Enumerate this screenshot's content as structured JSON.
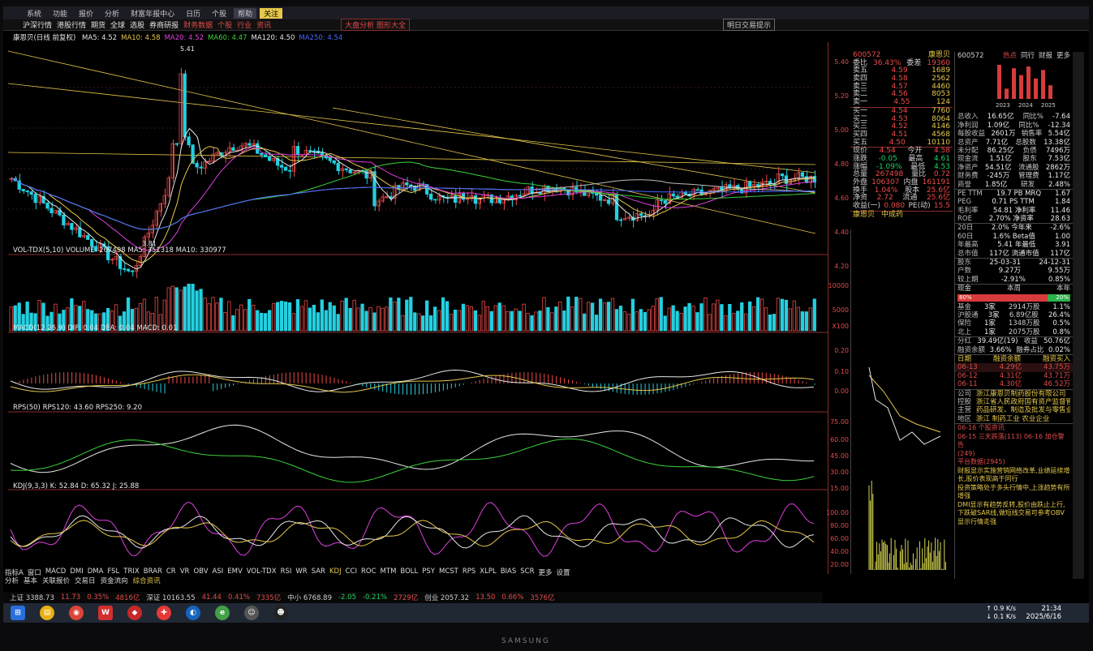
{
  "menubar": {
    "items": [
      "系统",
      "功能",
      "报价",
      "分析",
      "财富年报中心",
      "日历",
      "个股",
      "帮助",
      "关注"
    ],
    "active_index": 7,
    "hl_index": 8
  },
  "toolbar": {
    "items": [
      "沪深行情",
      "港股行情",
      "期货",
      "全球",
      "选股",
      "券商研报",
      "财务数据",
      "个股",
      "行业",
      "资讯"
    ],
    "alert_box": "大盘分析 图形大全",
    "right_box": "明日交易提示"
  },
  "chart": {
    "title": "康恩贝(日线 前复权)",
    "ma_legend": [
      {
        "text": "MA5: 4.52",
        "color": "#e8e8e8"
      },
      {
        "text": "MA10: 4.58",
        "color": "#e6c84a"
      },
      {
        "text": "MA20: 4.52",
        "color": "#e040e0"
      },
      {
        "text": "MA60: 4.47",
        "color": "#3cd23c"
      },
      {
        "text": "MA120: 4.50",
        "color": "#e8e8e8"
      },
      {
        "text": "MA250: 4.54",
        "color": "#4466ff"
      }
    ],
    "high_label": "5.41",
    "low_label": "3.81",
    "volume_legend": "VOL-TDX(5,10) VOLUME: 267498 MA5: 351318 MA10: 330977",
    "macd_legend": "MACD(12,26,9) DIF: 0.04 DEA: 0.04 MACD: 0.01",
    "rps_legend": "RPS(50) RPS120: 43.60 RPS250: 9.20",
    "kdj_legend": "KDJ(9,3,3) K: 52.84 D: 65.32 J: 25.88"
  },
  "axis_ticks": [
    "5.40",
    "5.20",
    "5.00",
    "4.80",
    "4.60",
    "4.40",
    "4.20",
    "10000",
    "5000",
    "X100",
    "0.20",
    "0.10",
    "0.00",
    "75.00",
    "60.00",
    "45.00",
    "30.00",
    "15.00",
    "100.00",
    "80.00",
    "60.00",
    "40.00",
    "20.00"
  ],
  "quote": {
    "code": "600572",
    "name": "康恩贝",
    "weibi_label": "委比",
    "weibi": "36.43%",
    "weicha_label": "委差",
    "weicha": "19360",
    "sell": [
      {
        "label": "卖五",
        "price": "4.59",
        "vol": "1689"
      },
      {
        "label": "卖四",
        "price": "4.58",
        "vol": "2562"
      },
      {
        "label": "卖三",
        "price": "4.57",
        "vol": "4460"
      },
      {
        "label": "卖二",
        "price": "4.56",
        "vol": "8053"
      },
      {
        "label": "卖一",
        "price": "4.55",
        "vol": "124"
      }
    ],
    "buy": [
      {
        "label": "买一",
        "price": "4.54",
        "vol": "7760"
      },
      {
        "label": "买二",
        "price": "4.53",
        "vol": "8064"
      },
      {
        "label": "买三",
        "price": "4.52",
        "vol": "4146"
      },
      {
        "label": "买四",
        "price": "4.51",
        "vol": "4568"
      },
      {
        "label": "买五",
        "price": "4.50",
        "vol": "10110"
      }
    ],
    "stats": [
      [
        "现价",
        "4.54",
        "今开",
        "4.58"
      ],
      [
        "涨跌",
        "-0.05",
        "最高",
        "4.61"
      ],
      [
        "涨幅",
        "-1.09%",
        "最低",
        "4.53"
      ],
      [
        "总量",
        "267498",
        "量比",
        "0.72"
      ],
      [
        "外盘",
        "106307",
        "内盘",
        "161191"
      ],
      [
        "换手",
        "1.04%",
        "股本",
        "25.6亿"
      ],
      [
        "净资",
        "2.72",
        "流通",
        "25.6亿"
      ],
      [
        "收益(一)",
        "0.080",
        "PE(动)",
        "15.5"
      ]
    ],
    "tabs": [
      "康恩贝",
      "中成药"
    ]
  },
  "fund": {
    "code": "600572",
    "tabs": [
      "热点",
      "同行",
      "财报",
      "更多"
    ],
    "bar_years": [
      "2023",
      "2024",
      "2025"
    ],
    "rows": [
      [
        "总收入",
        "16.65亿",
        "同比%",
        "-7.64"
      ],
      [
        "净利润",
        "1.09亿",
        "同比%",
        "-12.34"
      ],
      [
        "每股收益",
        "2601万",
        "销售率",
        "5.54亿"
      ],
      [
        "总资产",
        "7.71亿",
        "总股数",
        "13.38亿"
      ],
      [
        "未分配",
        "86.25亿",
        "负债",
        "7496万"
      ],
      [
        "现金流",
        "1.51亿",
        "股东",
        "7.53亿"
      ],
      [
        "净资产",
        "54.51亿",
        "流通股",
        "2862万"
      ],
      [
        "财务费",
        "-245万",
        "管理费",
        "1.17亿"
      ],
      [
        "商誉",
        "1.85亿",
        "研发",
        "2.48%"
      ]
    ],
    "pe_rows": [
      [
        "PE TTM",
        "19.7 PB MRQ",
        "1.67"
      ],
      [
        "PEG",
        "0.71 PS TTM",
        "1.84"
      ],
      [
        "毛利率",
        "54.81 净利率",
        "11.46"
      ],
      [
        "ROE",
        "2.70% 净资率",
        "28.63"
      ]
    ],
    "perf_rows": [
      [
        "20日",
        "2.0% 今年来",
        "-2.6%"
      ],
      [
        "60日",
        "1.6% Beta值",
        "1.00"
      ],
      [
        "年最高",
        "5.41 年最低",
        "3.91"
      ],
      [
        "总市值",
        "117亿 流通市值",
        "117亿"
      ]
    ],
    "date_rows": [
      [
        "股东",
        "25-03-31",
        "24-12-31"
      ],
      [
        "户数",
        "9.27万",
        "9.55万"
      ],
      [
        "较上期",
        "-2.91%",
        "0.85%"
      ]
    ],
    "flow_labels": [
      "现金",
      "本周",
      "本年"
    ],
    "flow_pct_left": "80%",
    "flow_pct_right": "20%",
    "holder_rows": [
      [
        "基金",
        "3家",
        "2914万股",
        "1.1%"
      ],
      [
        "沪股通",
        "3家",
        "6.89亿股",
        "26.4%"
      ],
      [
        "保险",
        "1家",
        "1348万股",
        "0.5%"
      ],
      [
        "北上",
        "1家",
        "2075万股",
        "0.8%"
      ]
    ],
    "rate_rows": [
      [
        "分红",
        "39.49亿(19)",
        "收益",
        "50.76亿"
      ],
      [
        "融资余额",
        "3.66%",
        "融券占比",
        "0.02%"
      ]
    ],
    "margin_head": [
      "日期",
      "融资余额",
      "融资买入"
    ],
    "margin_rows": [
      [
        "06-13",
        "4.29亿",
        "43.75万"
      ],
      [
        "06-12",
        "4.31亿",
        "43.71万"
      ],
      [
        "06-11",
        "4.30亿",
        "46.52万"
      ]
    ],
    "company": [
      [
        "公司",
        "浙江康恩贝制药股份有限公司"
      ],
      [
        "控股",
        "浙江省人民政府国有资产监督管理"
      ],
      [
        "主营",
        "药品研发、制造及批发与零售业务"
      ],
      [
        "地区",
        "浙江 制药工业 农业企业"
      ]
    ],
    "news": [
      "06-16 个股资讯",
      "06-15 三天跌落(113) 06-16 加仓警告",
      "(249)",
      "平台数据(2945)",
      "财报显示实施营销网络改革,业绩延续增长,股价表现高于同行",
      "投资策略处于多头行情中,上涨趋势有所增强",
      "DMI显示有趋势反转,股价由跌止上行,下跌破SAR线,做短线交易可参考OBV显示行情走强"
    ]
  },
  "bottom_tabs_1": [
    "指标A",
    "窗口",
    "MACD",
    "DMI",
    "DMA",
    "FSL",
    "TRIX",
    "BRAR",
    "CR",
    "VR",
    "OBV",
    "ASI",
    "EMV",
    "VOL-TDX",
    "RSI",
    "WR",
    "SAR",
    "KDJ",
    "CCI",
    "ROC",
    "MTM",
    "BOLL",
    "PSY",
    "MCST",
    "RPS",
    "XLPL",
    "BIAS",
    "SCR",
    "更多",
    "设置"
  ],
  "bottom_tabs_2": [
    "分析",
    "基本",
    "关联报价",
    "交易日",
    "资金流向",
    "综合资讯"
  ],
  "status": [
    "上证 3388.73",
    "11.73",
    "0.35%",
    "4816亿",
    "深证 10163.55",
    "41.44",
    "0.41%",
    "7335亿",
    "中小 6768.89",
    "-2.05",
    "-0.21%",
    "2729亿",
    "创业 2057.32",
    "13.50",
    "0.66%",
    "3576亿"
  ],
  "taskbar": {
    "time": "21:34",
    "date": "2025/6/16",
    "net_up": "↑ 0.9 K/s",
    "net_down": "↓ 0.1 K/s",
    "bezel": "SAMSUNG"
  },
  "colors": {
    "up": "#ef4a4a",
    "down": "#23d0e0",
    "accent": "#e6c84a",
    "green": "#3cd23c",
    "purple": "#e040e0",
    "white": "#e8e8e8",
    "blue": "#4466ff"
  }
}
